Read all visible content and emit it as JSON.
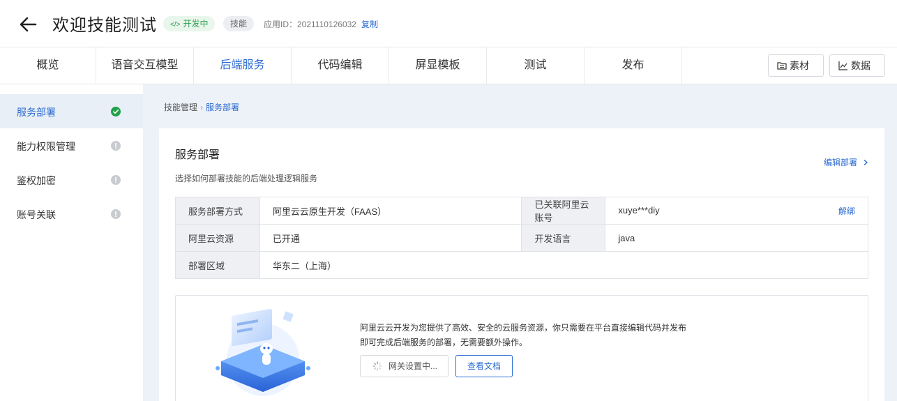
{
  "header": {
    "title": "欢迎技能测试",
    "status_badge": "开发中",
    "type_badge": "技能",
    "app_id_label": "应用ID：2021110126032",
    "copy_label": "复制"
  },
  "nav": {
    "tabs": [
      "概览",
      "语音交互模型",
      "后端服务",
      "代码编辑",
      "屏显模板",
      "测试",
      "发布"
    ],
    "active_tab": "后端服务",
    "materials_label": "素材",
    "data_label": "数据"
  },
  "sidebar": {
    "items": [
      {
        "label": "服务部署",
        "status": "done"
      },
      {
        "label": "能力权限管理",
        "status": "pending"
      },
      {
        "label": "鉴权加密",
        "status": "pending"
      },
      {
        "label": "账号关联",
        "status": "pending"
      }
    ]
  },
  "breadcrumb": {
    "parent": "技能管理",
    "current": "服务部署"
  },
  "card": {
    "title": "服务部署",
    "description": "选择如何部署技能的后端处理逻辑服务",
    "edit_link": "编辑部署",
    "rows": [
      {
        "k1": "服务部署方式",
        "v1": "阿里云云原生开发（FAAS）",
        "k2": "已关联阿里云账号",
        "v2": "xuye***diy",
        "action": "解绑"
      },
      {
        "k1": "阿里云资源",
        "v1": "已开通",
        "k2": "开发语言",
        "v2": "java"
      },
      {
        "k1": "部署区域",
        "v1": "华东二（上海）"
      }
    ]
  },
  "promo": {
    "text": "阿里云云开发为您提供了高效、安全的云服务资源，你只需要在平台直接编辑代码并发布即可完成后端服务的部署，无需要额外操作。",
    "loading_button": "网关设置中...",
    "doc_button": "查看文档"
  },
  "colors": {
    "accent": "#2b6bd1",
    "success": "#23a04a",
    "pending": "#c8cbd0"
  }
}
